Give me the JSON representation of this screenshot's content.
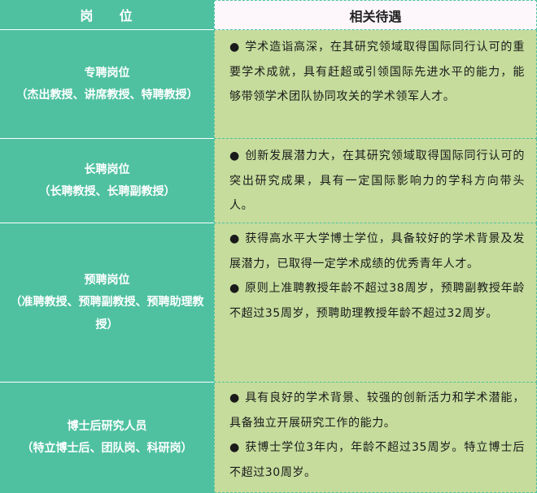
{
  "header": {
    "left": "岗    位",
    "right": "相关待遇"
  },
  "rows": [
    {
      "title": "专聘岗位",
      "sub": "（杰出教授、讲席教授、特聘教授）",
      "bullets": [
        "学术造诣高深，在其研究领域取得国际同行认可的重要学术成就，具有赶超或引领国际先进水平的能力，能够带领学术团队协同攻关的学术领军人才。"
      ]
    },
    {
      "title": "长聘岗位",
      "sub": "（长聘教授、长聘副教授）",
      "bullets": [
        "创新发展潜力大，在其研究领域取得国际同行认可的突出研究成果，具有一定国际影响力的学科方向带头人。"
      ]
    },
    {
      "title": "预聘岗位",
      "sub": "（准聘教授、预聘副教授、预聘助理教授）",
      "bullets": [
        "获得高水平大学博士学位，具备较好的学术背景及发展潜力，已取得一定学术成绩的优秀青年人才。",
        "原则上准聘教授年龄不超过38周岁，预聘副教授年龄不超过35周岁，预聘助理教授年龄不超过32周岁。"
      ]
    },
    {
      "title": "博士后研究人员",
      "sub": "（特立博士后、团队岗、科研岗）",
      "bullets": [
        "具有良好的学术背景、较强的创新活力和学术潜能，具备独立开展研究工作的能力。",
        "获博士学位3年内，年龄不超过35周岁。特立博士后不超过30周岁。"
      ]
    }
  ],
  "colors": {
    "teal": "#4fc1a0",
    "green": "#c5dc9c",
    "header_bg": "#fdf7fb"
  }
}
